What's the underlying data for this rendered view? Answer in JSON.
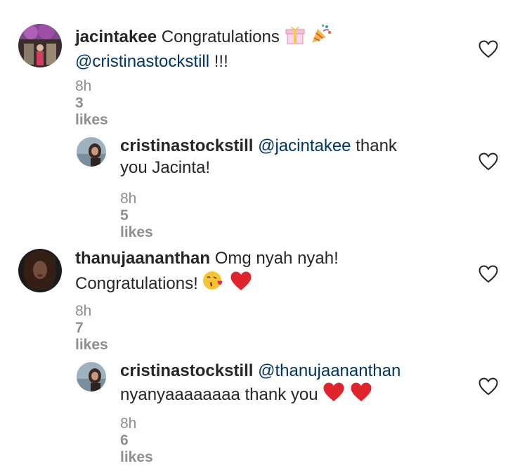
{
  "comments": [
    {
      "username": "jacintakee",
      "line1": "Congratulations",
      "mention": "@cristinastockstill",
      "tail": " !!!",
      "time": "8h",
      "likes": "3 likes"
    },
    {
      "username": "cristinastockstill",
      "mention": "@jacintakee",
      "line1_tail": " thank",
      "line2": "you Jacinta!",
      "time": "8h",
      "likes": "5 likes"
    },
    {
      "username": "thanujaananthan",
      "line1": "Omg nyah nyah!",
      "line2": "Congratulations!",
      "time": "8h",
      "likes": "7 likes"
    },
    {
      "username": "cristinastockstill",
      "mention": "@thanujaananthan",
      "line2": "nyanyaaaaaaaa thank you",
      "time": "8h",
      "likes": "6 likes"
    }
  ],
  "colors": {
    "text": "#262626",
    "mention": "#003569",
    "meta": "#8e8e8e",
    "heart_outline": "#262626"
  },
  "icons": {
    "like": "heart-outline-icon",
    "emoji_gift": "gift-emoji",
    "emoji_party": "party-popper-emoji",
    "emoji_kiss": "kissing-face-emoji",
    "emoji_heart": "red-heart-emoji"
  }
}
